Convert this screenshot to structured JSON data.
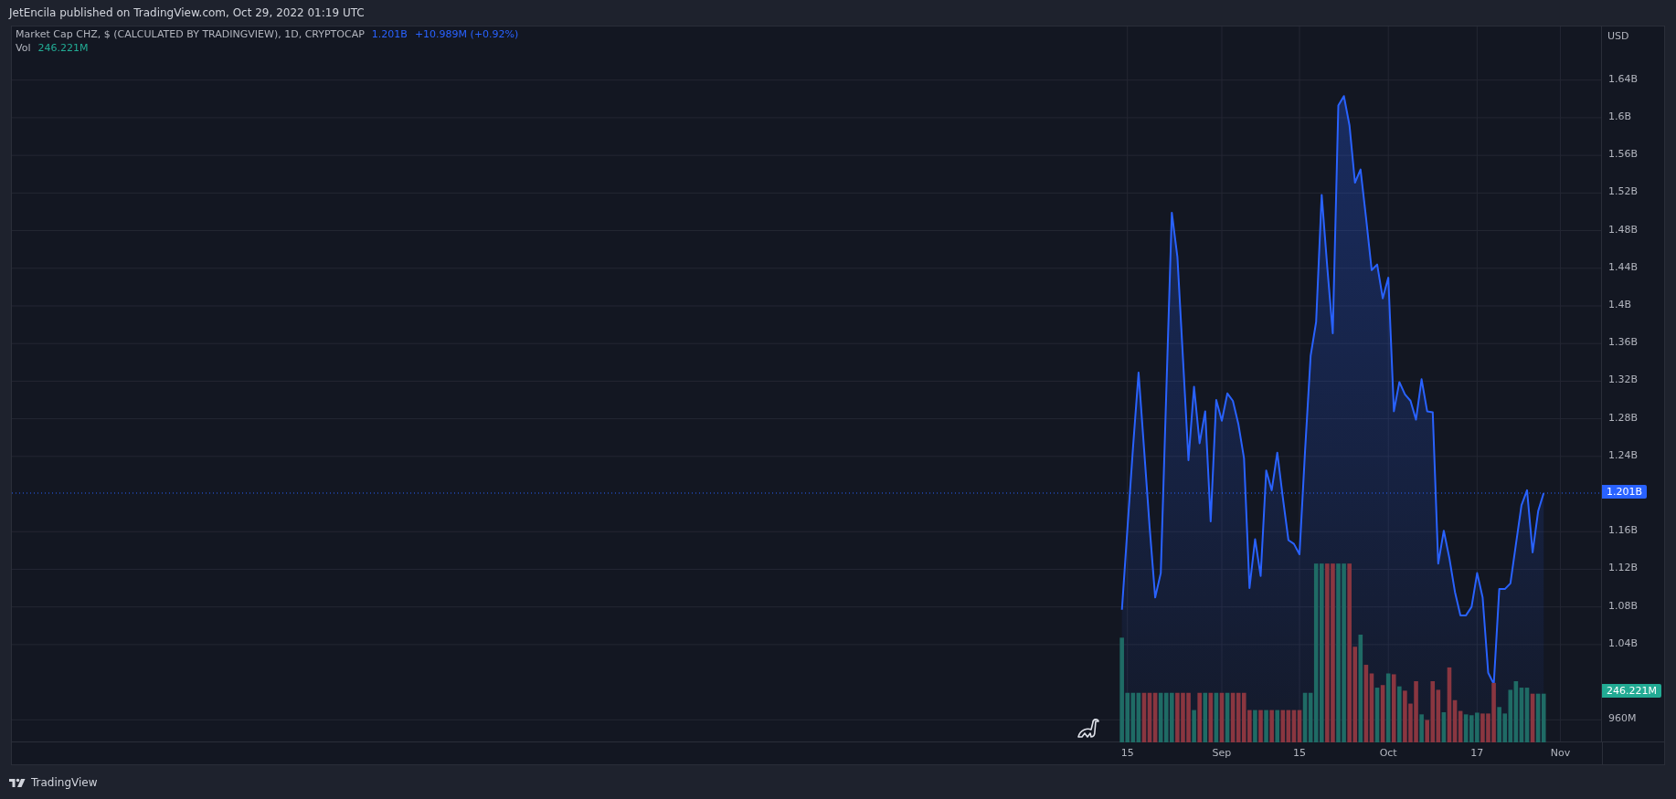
{
  "header": {
    "text": "JetEncila published on TradingView.com, Oct 29, 2022 01:19 UTC"
  },
  "legend": {
    "last": "1.201B",
    "change": "+10.989M (+0.92%)",
    "vol_label": "Vol",
    "vol_value": "246.221M"
  },
  "price_axis": {
    "currency": "USD",
    "last_price_badge": "1.201B",
    "volume_badge": "246.221M"
  },
  "chart": {
    "chart_data": {
      "type": "area",
      "categories": [
        null,
        "15",
        null,
        null,
        null,
        null,
        null,
        null,
        null,
        null,
        null,
        null,
        null,
        null,
        null,
        null,
        null,
        null,
        "Sep",
        null,
        null,
        null,
        null,
        null,
        null,
        null,
        null,
        null,
        null,
        null,
        null,
        null,
        "15",
        null,
        null,
        null,
        null,
        null,
        null,
        null,
        null,
        null,
        null,
        null,
        null,
        null,
        null,
        null,
        "Oct",
        null,
        null,
        null,
        null,
        null,
        null,
        null,
        null,
        null,
        null,
        null,
        null,
        null,
        null,
        null,
        "17",
        null,
        null,
        null,
        null,
        null,
        null,
        null,
        null,
        null,
        null,
        null,
        null,
        null,
        null,
        "Nov"
      ],
      "series": [
        {
          "name": "Market Cap CHZ, $ (CALCULATED BY TRADINGVIEW), 1D, CRYPTOCAP",
          "color": "#2962ff",
          "values": [
            1077000000,
            1163000000,
            1249000000,
            1329000000,
            1247000000,
            1165000000,
            1090000000,
            1116000000,
            1307000000,
            1499000000,
            1452000000,
            1344000000,
            1236000000,
            1314000000,
            1254000000,
            1288000000,
            1171000000,
            1300000000,
            1278000000,
            1307000000,
            1299000000,
            1274000000,
            1238000000,
            1100000000,
            1152000000,
            1113000000,
            1225000000,
            1204000000,
            1244000000,
            1196000000,
            1151000000,
            1147000000,
            1136000000,
            1246000000,
            1347000000,
            1383000000,
            1518000000,
            1441000000,
            1371000000,
            1613000000,
            1623000000,
            1592000000,
            1531000000,
            1545000000,
            1493000000,
            1438000000,
            1444000000,
            1408000000,
            1430000000,
            1288000000,
            1319000000,
            1306000000,
            1299000000,
            1279000000,
            1322000000,
            1288000000,
            1287000000,
            1126000000,
            1161000000,
            1132000000,
            1096000000,
            1071000000,
            1071000000,
            1080000000,
            1116000000,
            1090000000,
            1010000000,
            998000000,
            1099000000,
            1099000000,
            1105000000,
            1147000000,
            1188000000,
            1204000000,
            1138000000,
            1182000000,
            1201000000,
            null,
            null,
            null
          ]
        }
      ],
      "ylim": [
        936000000,
        1697000000
      ],
      "grid": true,
      "ref_lines": [
        {
          "axis": "y",
          "value": 1201000000,
          "color": "#2962ff"
        }
      ],
      "yticks": [
        {
          "value": 960000000,
          "label": "960M"
        },
        {
          "value": 1040000000,
          "label": "1.04B"
        },
        {
          "value": 1080000000,
          "label": "1.08B"
        },
        {
          "value": 1120000000,
          "label": "1.12B"
        },
        {
          "value": 1160000000,
          "label": "1.16B"
        },
        {
          "value": 1240000000,
          "label": "1.24B"
        },
        {
          "value": 1280000000,
          "label": "1.28B"
        },
        {
          "value": 1320000000,
          "label": "1.32B"
        },
        {
          "value": 1360000000,
          "label": "1.36B"
        },
        {
          "value": 1400000000,
          "label": "1.4B"
        },
        {
          "value": 1440000000,
          "label": "1.44B"
        },
        {
          "value": 1480000000,
          "label": "1.48B"
        },
        {
          "value": 1520000000,
          "label": "1.52B"
        },
        {
          "value": 1560000000,
          "label": "1.56B"
        },
        {
          "value": 1600000000,
          "label": "1.6B"
        },
        {
          "value": 1640000000,
          "label": "1.64B"
        }
      ]
    }
  },
  "footer": {
    "brand": "TradingView"
  }
}
